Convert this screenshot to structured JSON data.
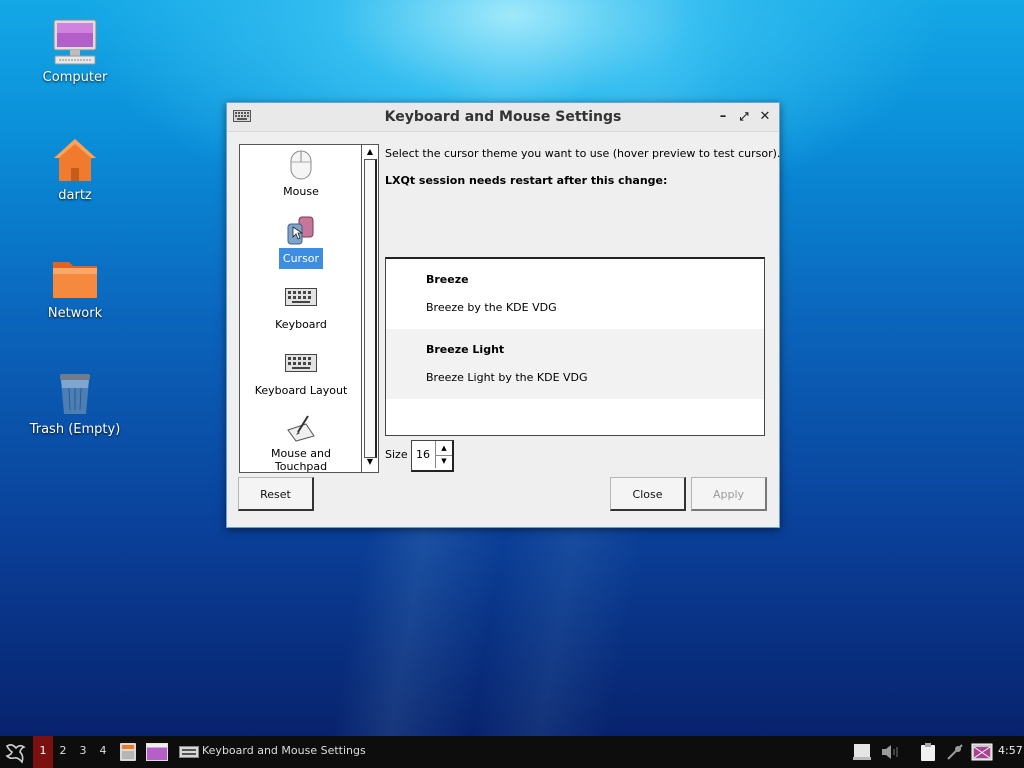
{
  "desktop": {
    "icons": [
      {
        "label": "Computer",
        "icon": "computer-icon"
      },
      {
        "label": "dartz",
        "icon": "home-folder-icon"
      },
      {
        "label": "Network",
        "icon": "network-folder-icon"
      },
      {
        "label": "Trash (Empty)",
        "icon": "trash-icon"
      }
    ]
  },
  "window": {
    "title": "Keyboard and Mouse Settings",
    "sidebar": [
      {
        "label": "Mouse",
        "icon": "mouse-icon"
      },
      {
        "label": "Cursor",
        "icon": "cursor-icon",
        "selected": true
      },
      {
        "label": "Keyboard",
        "icon": "keyboard-icon"
      },
      {
        "label": "Keyboard Layout",
        "icon": "keyboard-layout-icon"
      },
      {
        "label": "Mouse and Touchpad",
        "icon": "touchpad-icon"
      }
    ],
    "instruction": "Select the cursor theme you want to use (hover preview to test cursor).",
    "restart_note": "LXQt session needs restart after this change:",
    "themes": [
      {
        "name": "Breeze",
        "description": "Breeze by the KDE VDG"
      },
      {
        "name": "Breeze Light",
        "description": "Breeze Light by the KDE VDG"
      }
    ],
    "size_label": "Size",
    "size_value": "16",
    "buttons": {
      "reset": "Reset",
      "close": "Close",
      "apply": "Apply"
    }
  },
  "taskbar": {
    "desktops": [
      "1",
      "2",
      "3",
      "4"
    ],
    "active_desktop": "1",
    "task_label": "Keyboard and Mouse Settings",
    "clock": "4:57"
  },
  "colors": {
    "selection": "#3d8ee2",
    "active_desktop": "#7a1010"
  }
}
